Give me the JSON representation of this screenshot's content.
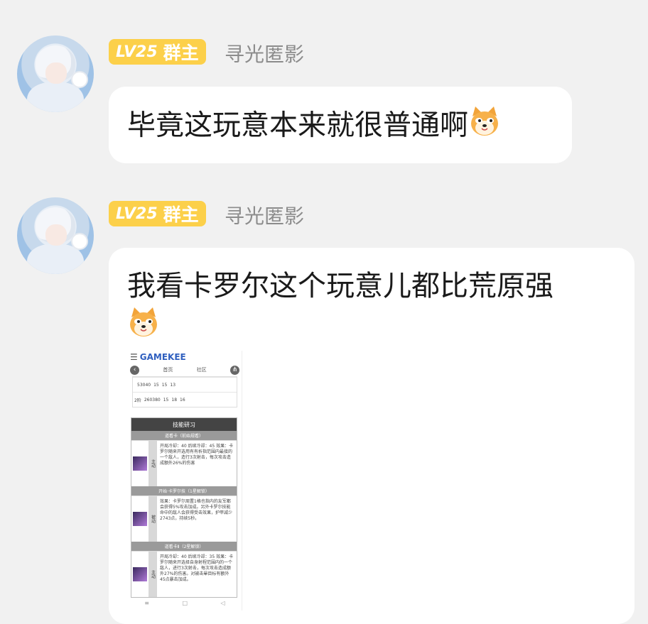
{
  "messages": [
    {
      "level": "LV25",
      "role": "群主",
      "nickname": "寻光匿影",
      "text": "毕竟这玩意本来就很普通啊",
      "emoji": "shiba-emoji"
    },
    {
      "level": "LV25",
      "role": "群主",
      "nickname": "寻光匿影",
      "text": "我看卡罗尔这个玩意儿都比荒原强",
      "emoji": "shiba-emoji",
      "image": {
        "site": "GAMEKEE",
        "nav_items": [
          "首页",
          "社区"
        ],
        "table_rows": [
          {
            "label": "",
            "value": "53040",
            "nums": [
              "15",
              "15",
              "13"
            ]
          },
          {
            "label": "2阶",
            "value": "260380",
            "nums": [
              "15",
              "18",
              "16"
            ]
          }
        ],
        "skills_title": "技能研习",
        "skills": [
          {
            "name": "道看卡（前始规看）",
            "tag": "主动",
            "desc": "开局冷却：40 后续冷却：45 效果：卡罗尔随来开选用有有析指范围内最接的一个敌人，造行3次射击，每次攻击造成额外26%的伤害"
          },
          {
            "name": "开始·卡罗尔技（1星解锁）",
            "tag": "被动",
            "desc": "效果：卡罗尔周置1格也指内的友军都会获得5%攻击加成。另外卡罗尔技能命中的敌人会获得受击效果，护甲减少2743点，持续5秒。"
          },
          {
            "name": "道看卡Ⅱ（2星解锁）",
            "tag": "主动",
            "desc": "开局冷却：40 后续冷却：35 效果：卡罗尔随来开选择自身射程范围内的一个敌人，进行3次射击，每次攻击造成额外27%的伤害。对被击晕目标有额外45点暴击加成。"
          }
        ]
      }
    }
  ],
  "colors": {
    "background": "#f1f1f1",
    "badge": "#fcd04a",
    "bubble": "#ffffff",
    "nickname": "#8c8c8c"
  }
}
